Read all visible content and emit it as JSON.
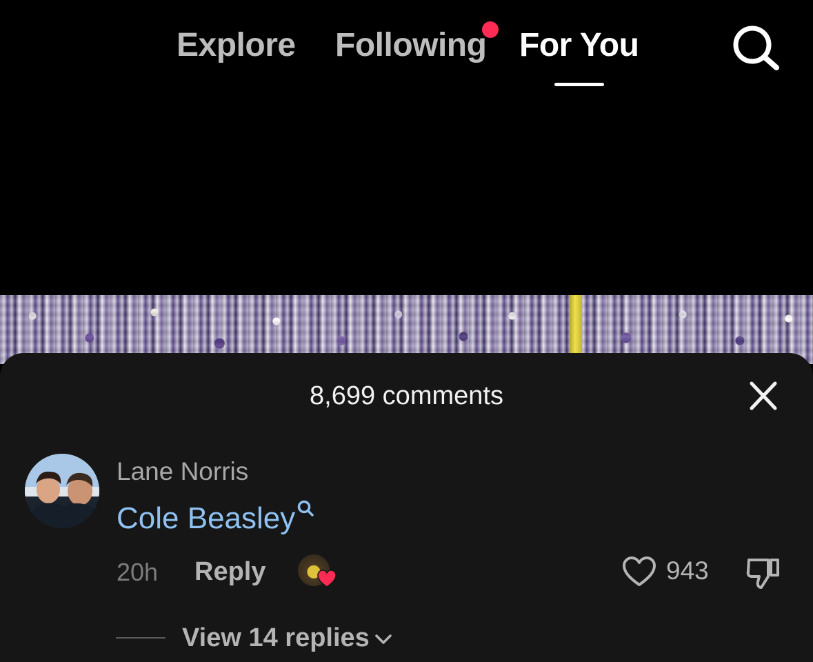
{
  "nav": {
    "tabs": [
      {
        "label": "Explore",
        "active": false
      },
      {
        "label": "Following",
        "active": false,
        "has_notification": true
      },
      {
        "label": "For You",
        "active": true
      }
    ],
    "search_icon": "search-icon",
    "notification_color": "#fe2c55"
  },
  "comments": {
    "count_label": "8,699 comments",
    "close_icon": "close-icon",
    "items": [
      {
        "username": "Lane Norris",
        "text": "Cole Beasley",
        "text_link_icon": "search-icon",
        "timestamp": "20h",
        "reply_label": "Reply",
        "liked_by_creator": true,
        "likes": "943",
        "replies_label": "View 14 replies"
      }
    ]
  },
  "colors": {
    "background": "#000000",
    "sheet": "#161616",
    "link": "#8fc2f2",
    "muted": "#a8a8a8",
    "heart": "#fe2c55"
  }
}
